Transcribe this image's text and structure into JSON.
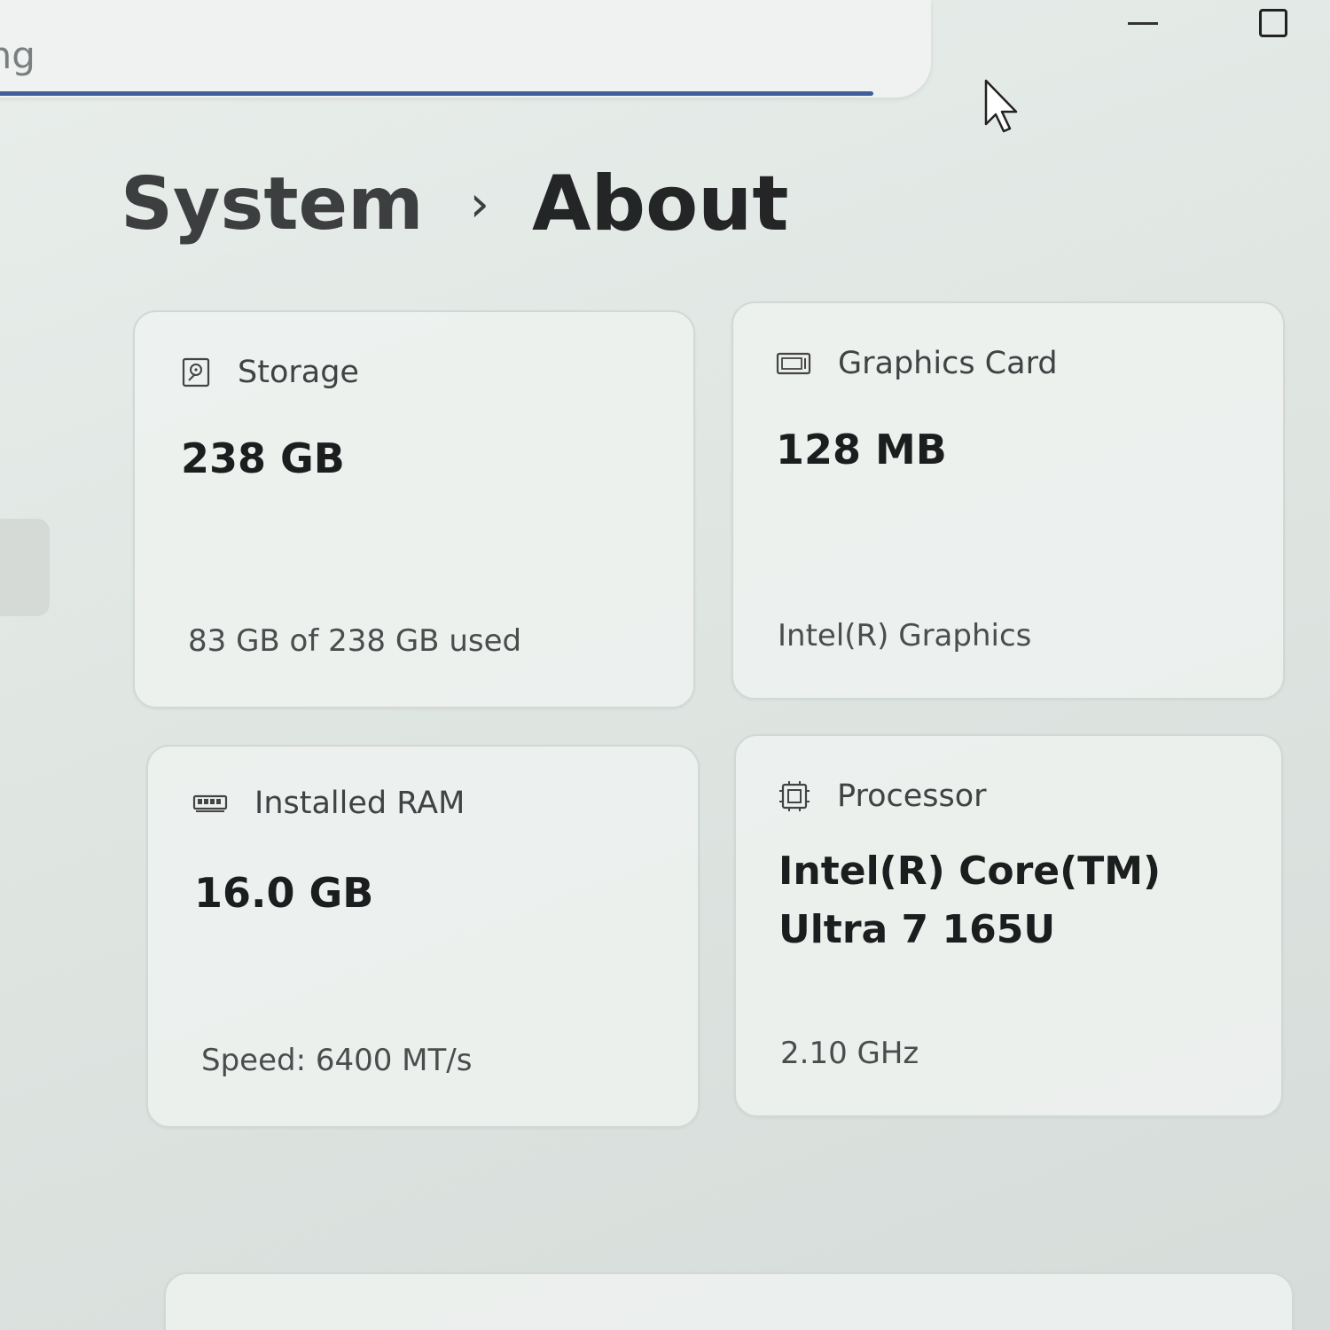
{
  "search": {
    "value": "tting"
  },
  "window_controls": {
    "minimize": "minimize-icon",
    "maximize": "maximize-icon"
  },
  "breadcrumb": {
    "parent": "System",
    "separator": "›",
    "current": "About"
  },
  "cards": {
    "storage": {
      "icon": "storage-drive-icon",
      "label": "Storage",
      "value": "238 GB",
      "detail": "83 GB of 238 GB used"
    },
    "graphics": {
      "icon": "graphics-card-icon",
      "label": "Graphics Card",
      "value": "128 MB",
      "detail": "Intel(R) Graphics"
    },
    "ram": {
      "icon": "ram-module-icon",
      "label": "Installed RAM",
      "value": "16.0 GB",
      "detail": "Speed: 6400 MT/s"
    },
    "processor": {
      "icon": "processor-chip-icon",
      "label": "Processor",
      "value": "Intel(R) Core(TM) Ultra 7 165U",
      "detail": "2.10 GHz"
    }
  },
  "colors": {
    "accent_underline": "#3e5f9a",
    "background": "#e3e9e6",
    "card": "#eef2f0"
  }
}
